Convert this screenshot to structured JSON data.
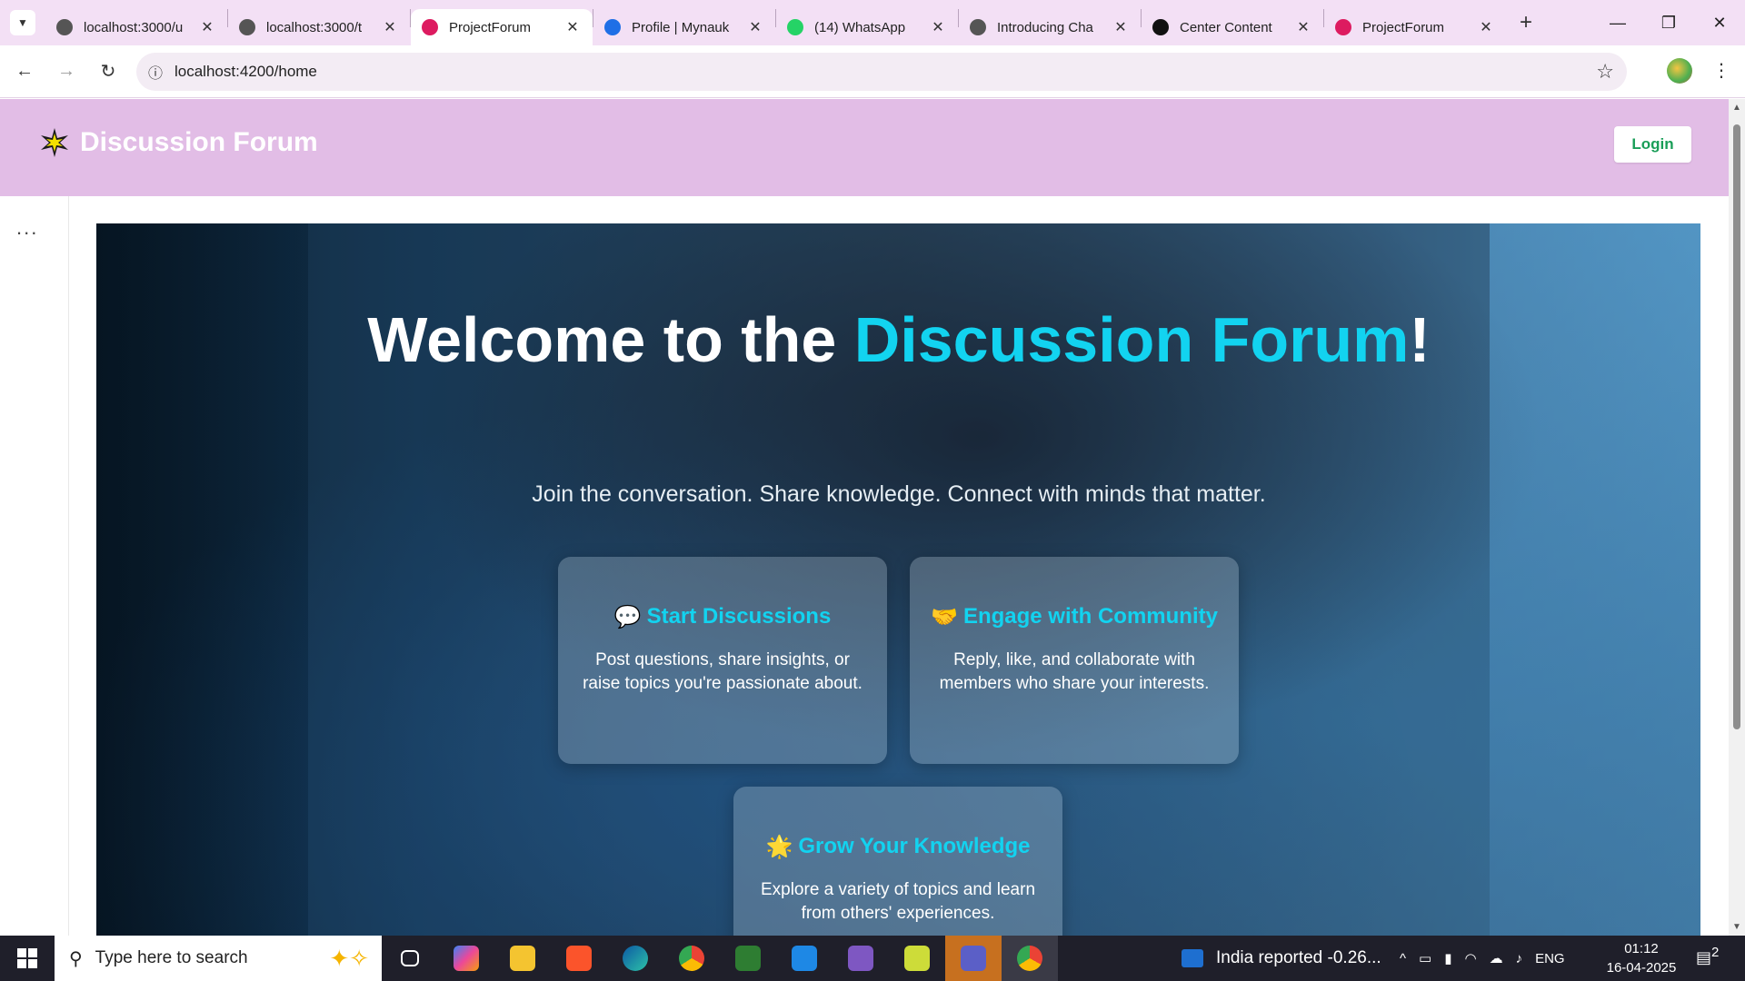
{
  "browser": {
    "tabs": [
      {
        "title": "localhost:3000/u",
        "favicon": "globe-icon",
        "color": "#555555",
        "active": false
      },
      {
        "title": "localhost:3000/t",
        "favicon": "globe-icon",
        "color": "#555555",
        "active": false
      },
      {
        "title": "ProjectForum",
        "favicon": "angular-icon",
        "color": "#dd1b60",
        "active": true
      },
      {
        "title": "Profile | Mynauk",
        "favicon": "profile-icon",
        "color": "#1f6fe6",
        "active": false
      },
      {
        "title": "(14) WhatsApp",
        "favicon": "whatsapp-icon",
        "color": "#25d366",
        "active": false
      },
      {
        "title": "Introducing Cha",
        "favicon": "openai-icon",
        "color": "#555555",
        "active": false
      },
      {
        "title": "Center Content",
        "favicon": "openai-icon",
        "color": "#111111",
        "active": false
      },
      {
        "title": "ProjectForum",
        "favicon": "angular-icon",
        "color": "#dd1b60",
        "active": false
      }
    ],
    "url": "localhost:4200/home"
  },
  "header": {
    "brand": "Discussion Forum",
    "login_label": "Login"
  },
  "sidebar": {
    "menu_glyph": "..."
  },
  "hero": {
    "title_part1": "Welcome to the ",
    "title_accent": "Discussion Forum",
    "title_end": "!",
    "subtitle": "Join the conversation. Share knowledge. Connect with minds that matter."
  },
  "features": [
    {
      "icon": "speech-bubble-icon",
      "emoji": "💬",
      "title": "Start Discussions",
      "text": "Post questions, share insights, or raise topics you're passionate about."
    },
    {
      "icon": "handshake-icon",
      "emoji": "🤝",
      "title": "Engage with Community",
      "text": "Reply, like, and collaborate with members who share your interests."
    },
    {
      "icon": "star-icon",
      "emoji": "🌟",
      "title": "Grow Your Knowledge",
      "text": "Explore a variety of topics and learn from others' experiences."
    }
  ],
  "taskbar": {
    "search_placeholder": "Type here to search",
    "news": "India reported -0.26...",
    "language": "ENG",
    "time": "01:12",
    "date": "16-04-2025",
    "notifications": "2"
  },
  "colors": {
    "accent": "#12d3f0",
    "header_bg": "#e2bde6",
    "login_text": "#1a9e58"
  }
}
